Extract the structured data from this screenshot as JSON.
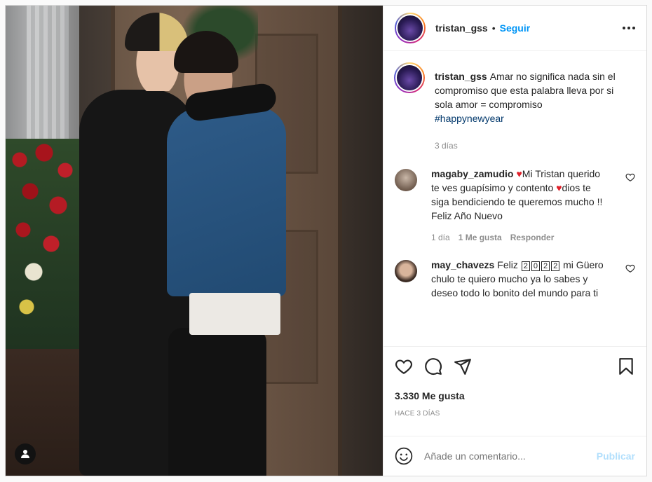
{
  "post": {
    "author": "tristan_gss",
    "follow_label": "Seguir",
    "separator": "•",
    "caption": "Amar no significa nada sin el compromiso que esta palabra lleva por si sola amor = compromiso",
    "hashtag": "#happynewyear",
    "caption_time": "3 días"
  },
  "comments": [
    {
      "user": "magaby_zamudio",
      "text_a": "Mi Tristan querido te ves guapísimo y contento",
      "text_b": "dios te siga bendiciendo te queremos mucho !! Feliz Año Nuevo",
      "time": "1 día",
      "likes": "1 Me gusta",
      "reply": "Responder"
    },
    {
      "user": "may_chavezs",
      "text_a": "Feliz",
      "year_digits": [
        "2",
        "0",
        "2",
        "2"
      ],
      "text_b": "mi Güero chulo te quiero mucho ya lo sabes y deseo todo lo bonito del mundo para ti"
    }
  ],
  "actions": {
    "likes": "3.330 Me gusta",
    "date": "HACE 3 DÍAS"
  },
  "add_comment": {
    "placeholder": "Añade un comentario...",
    "publish": "Publicar"
  },
  "icons": [
    "user-tag-icon",
    "more-icon",
    "heart-icon",
    "comment-icon",
    "share-icon",
    "save-icon",
    "emoji-icon"
  ],
  "colors": {
    "link": "#0095f6",
    "hashtag": "#00376b",
    "muted": "#8e8e8e",
    "publish_disabled": "#b2dffc",
    "heart_emoji": "#e0212b"
  }
}
